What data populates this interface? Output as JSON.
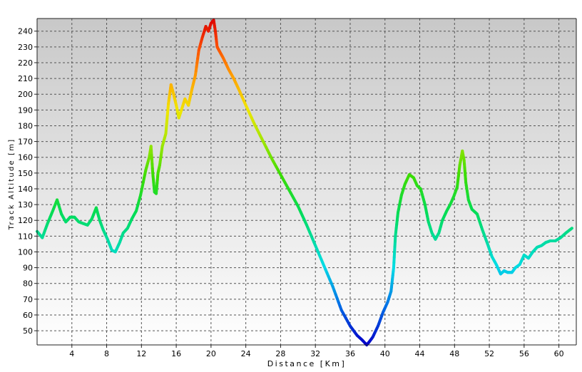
{
  "chart_data": {
    "type": "line",
    "title": "",
    "xlabel": "Distance [Km]",
    "ylabel": "Track Altitude [m]",
    "xlim": [
      0,
      62
    ],
    "ylim": [
      41,
      248
    ],
    "x_ticks": [
      4,
      8,
      12,
      16,
      20,
      24,
      28,
      32,
      36,
      40,
      44,
      48,
      52,
      56,
      60
    ],
    "y_ticks": [
      50,
      60,
      70,
      80,
      90,
      100,
      110,
      120,
      130,
      140,
      150,
      160,
      170,
      180,
      190,
      200,
      210,
      220,
      230,
      240
    ],
    "x_tick_labels": [
      "4",
      "8",
      "12",
      "16",
      "20",
      "24",
      "28",
      "32",
      "36",
      "40",
      "44",
      "48",
      "52",
      "56",
      "60"
    ],
    "y_tick_labels": [
      "50",
      "60",
      "70",
      "80",
      "90",
      "100",
      "110",
      "120",
      "130",
      "140",
      "150",
      "160",
      "170",
      "180",
      "190",
      "200",
      "210",
      "220",
      "230",
      "240"
    ],
    "grid": true,
    "legend": "none",
    "colormap": "altitude: blue (low) to red (high)",
    "colors": {
      "background_top": "#c8c8c8",
      "background_bottom": "#ffffff",
      "grid": "#555555",
      "low": "#0000c8",
      "high": "#e00000"
    },
    "series": [
      {
        "x": [
          0,
          0.6,
          1.2,
          1.8,
          2.3,
          2.8,
          3.3,
          3.8,
          4.3,
          4.8,
          5.3,
          5.8,
          6.3,
          6.8,
          7.2,
          7.6,
          8.1,
          8.6,
          9.0,
          9.5,
          9.9,
          10.4,
          10.9,
          11.4,
          11.9,
          12.5,
          12.9,
          13.1,
          13.3,
          13.5,
          13.7,
          13.9,
          14.1,
          14.4,
          14.8,
          15.1,
          15.4,
          15.7,
          16.0,
          16.3,
          16.6,
          17.0,
          17.4,
          17.8,
          18.2,
          18.6,
          19.0,
          19.4,
          19.7,
          20.0,
          20.3,
          20.5,
          20.7,
          21.0,
          21.4,
          22.0,
          22.6,
          23.2,
          24.0,
          25.0,
          26.0,
          27.0,
          28.0,
          29.0,
          30.0,
          31.0,
          32.0,
          33.0,
          34.0,
          35.0,
          36.0,
          36.8,
          37.4,
          37.9,
          38.2,
          38.6,
          39.2,
          39.8,
          40.3,
          40.7,
          41.0,
          41.2,
          41.5,
          41.9,
          42.3,
          42.8,
          43.3,
          43.7,
          44.1,
          44.6,
          45.0,
          45.4,
          45.8,
          46.2,
          46.6,
          47.1,
          47.5,
          47.9,
          48.3,
          48.6,
          48.9,
          49.1,
          49.3,
          49.6,
          50.0,
          50.6,
          51.2,
          51.8,
          52.3,
          52.8,
          53.3,
          53.7,
          54.1,
          54.6,
          55.0,
          55.5,
          56.0,
          56.5,
          57.0,
          57.5,
          58.0,
          58.5,
          59.0,
          59.6,
          60.2,
          60.8,
          61.5
        ],
        "y": [
          113,
          109,
          118,
          126,
          133,
          124,
          119,
          122,
          122,
          119,
          118,
          117,
          121,
          128,
          120,
          114,
          108,
          101,
          100,
          106,
          112,
          115,
          121,
          126,
          136,
          152,
          160,
          167,
          150,
          138,
          137,
          150,
          155,
          167,
          175,
          194,
          206,
          200,
          193,
          185,
          190,
          197,
          193,
          203,
          212,
          228,
          236,
          243,
          240,
          245,
          247,
          240,
          230,
          227,
          223,
          216,
          210,
          203,
          193,
          181,
          170,
          159,
          149,
          139,
          129,
          117,
          104,
          91,
          78,
          63,
          53,
          47,
          44,
          41,
          43,
          46,
          53,
          62,
          68,
          75,
          90,
          110,
          125,
          136,
          143,
          149,
          147,
          142,
          140,
          130,
          119,
          112,
          108,
          112,
          120,
          126,
          130,
          135,
          141,
          155,
          164,
          158,
          144,
          133,
          127,
          124,
          114,
          105,
          97,
          92,
          86,
          88,
          87,
          87,
          90,
          92,
          98,
          96,
          100,
          103,
          104,
          106,
          107,
          107,
          109,
          112,
          115
        ]
      }
    ]
  }
}
